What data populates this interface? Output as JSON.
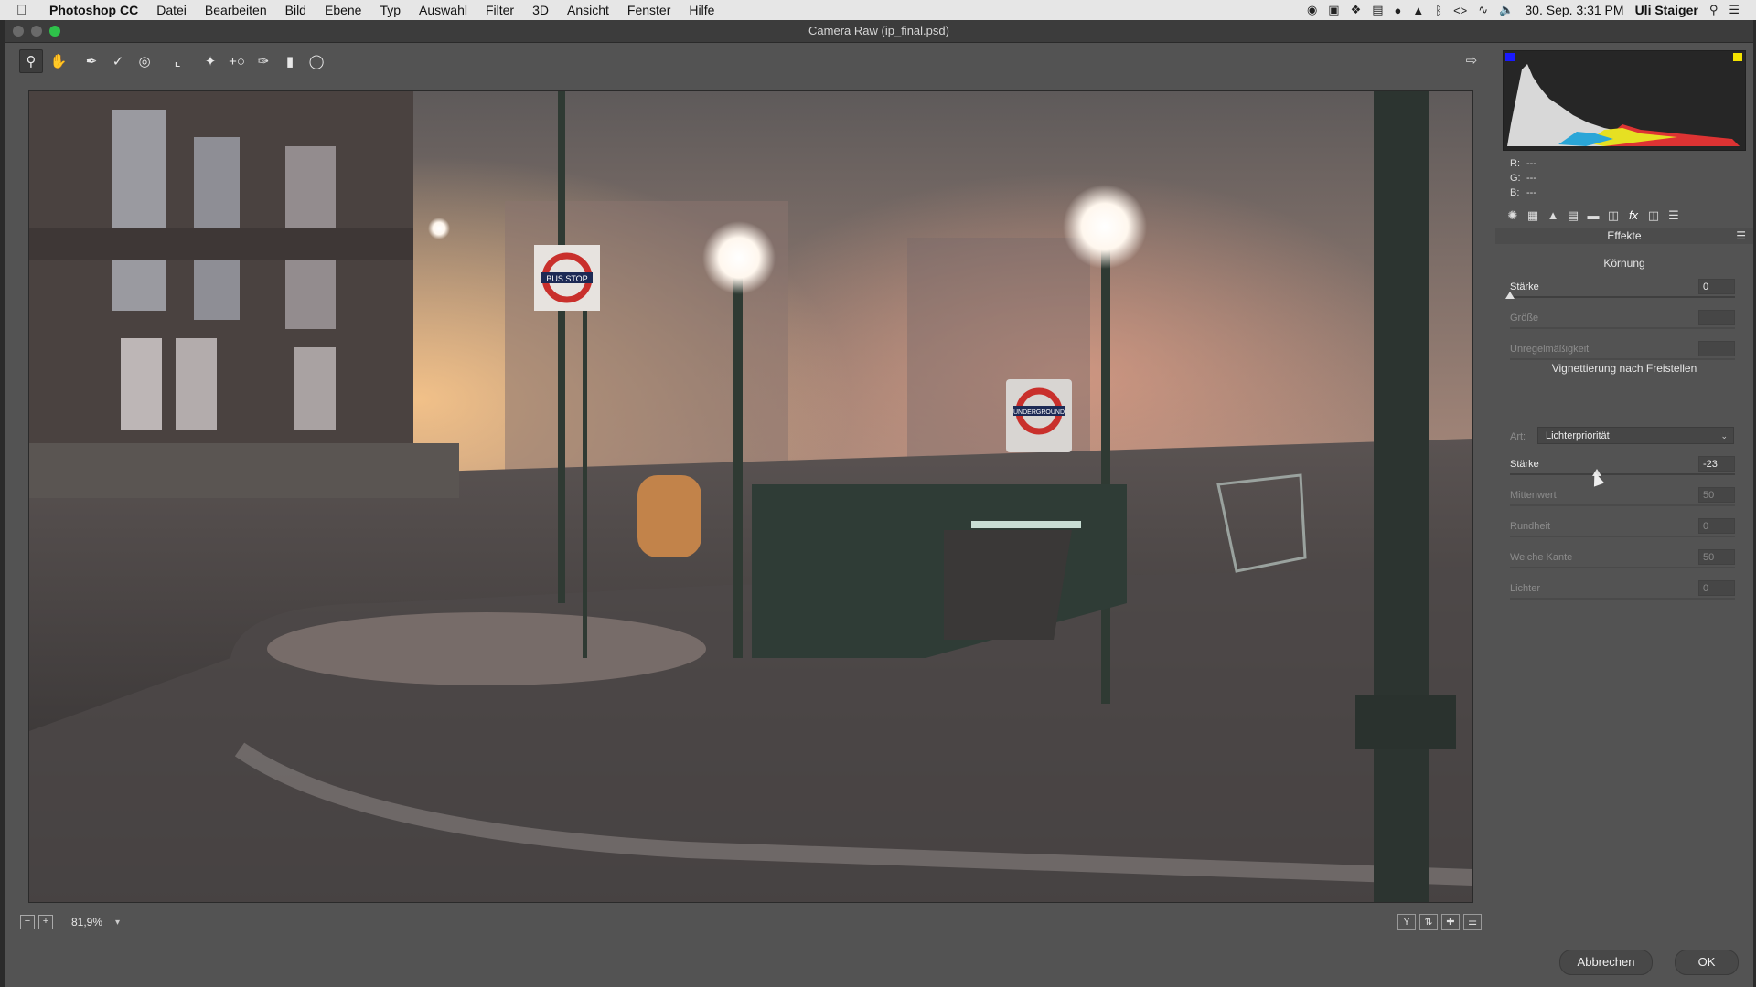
{
  "menubar": {
    "app_name": "Photoshop CC",
    "items": [
      "Datei",
      "Bearbeiten",
      "Bild",
      "Ebene",
      "Typ",
      "Auswahl",
      "Filter",
      "3D",
      "Ansicht",
      "Fenster",
      "Hilfe"
    ],
    "datetime": "30. Sep.  3:31 PM",
    "user": "Uli Staiger"
  },
  "window": {
    "title": "Camera Raw (ip_final.psd)"
  },
  "status": {
    "zoom": "81,9%"
  },
  "histogram": {
    "r_label": "R:",
    "g_label": "G:",
    "b_label": "B:",
    "r": "---",
    "g": "---",
    "b": "---"
  },
  "panel": {
    "title": "Effekte",
    "grain": {
      "title": "Körnung",
      "rows": [
        {
          "label": "Stärke",
          "value": "0",
          "pos": 0.0,
          "enabled": true
        },
        {
          "label": "Größe",
          "value": "",
          "pos": null,
          "enabled": false
        },
        {
          "label": "Unregelmäßigkeit",
          "value": "",
          "pos": null,
          "enabled": false
        }
      ]
    },
    "vignette": {
      "title": "Vignettierung nach Freistellen",
      "art_label": "Art:",
      "art_value": "Lichterpriorität",
      "rows": [
        {
          "label": "Stärke",
          "value": "-23",
          "pos": 0.385,
          "enabled": true
        },
        {
          "label": "Mittenwert",
          "value": "50",
          "pos": null,
          "enabled": false
        },
        {
          "label": "Rundheit",
          "value": "0",
          "pos": null,
          "enabled": false
        },
        {
          "label": "Weiche Kante",
          "value": "50",
          "pos": null,
          "enabled": false
        },
        {
          "label": "Lichter",
          "value": "0",
          "pos": null,
          "enabled": false
        }
      ]
    }
  },
  "buttons": {
    "cancel": "Abbrechen",
    "ok": "OK"
  },
  "image_signs": {
    "bus_stop": "BUS STOP",
    "underground": "UNDERGROUND"
  }
}
